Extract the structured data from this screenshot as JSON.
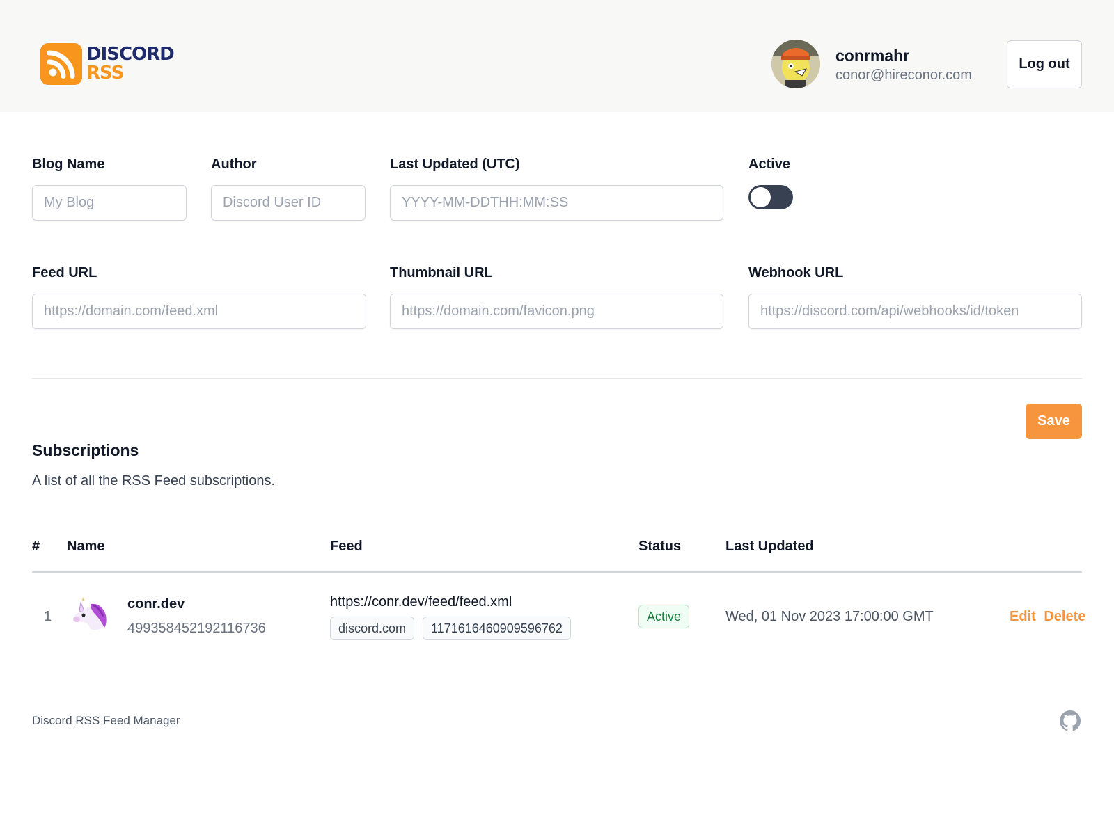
{
  "brand": {
    "line1": "DISCORD",
    "line2": "RSS",
    "badge_color": "#f7951d",
    "text_color": "#1f2a6b"
  },
  "user": {
    "name": "conrmahr",
    "email": "conor@hireconor.com",
    "logout_label": "Log out"
  },
  "form": {
    "blog_name": {
      "label": "Blog Name",
      "placeholder": "My Blog"
    },
    "author": {
      "label": "Author",
      "placeholder": "Discord User ID"
    },
    "last_updated": {
      "label": "Last Updated (UTC)",
      "placeholder": "YYYY-MM-DDTHH:MM:SS"
    },
    "active": {
      "label": "Active",
      "checked": false
    },
    "feed_url": {
      "label": "Feed URL",
      "placeholder": "https://domain.com/feed.xml"
    },
    "thumbnail_url": {
      "label": "Thumbnail URL",
      "placeholder": "https://domain.com/favicon.png"
    },
    "webhook_url": {
      "label": "Webhook URL",
      "placeholder": "https://discord.com/api/webhooks/id/token"
    },
    "save_label": "Save"
  },
  "subscriptions": {
    "title": "Subscriptions",
    "description": "A list of all the RSS Feed subscriptions.",
    "columns": [
      "#",
      "Name",
      "Feed",
      "Status",
      "Last Updated"
    ],
    "rows": [
      {
        "index": "1",
        "icon": "unicorn-icon",
        "name": "conr.dev",
        "author_id": "499358452192116736",
        "feed_url": "https://conr.dev/feed/feed.xml",
        "webhook_domain": "discord.com",
        "webhook_id": "1171616460909596762",
        "status": "Active",
        "last_updated": "Wed, 01 Nov 2023 17:00:00 GMT",
        "edit_label": "Edit",
        "delete_label": "Delete"
      }
    ]
  },
  "footer": {
    "text": "Discord RSS Feed Manager",
    "icon": "github-icon"
  },
  "colors": {
    "accent": "#f7953f",
    "status_active": "#15803d"
  }
}
